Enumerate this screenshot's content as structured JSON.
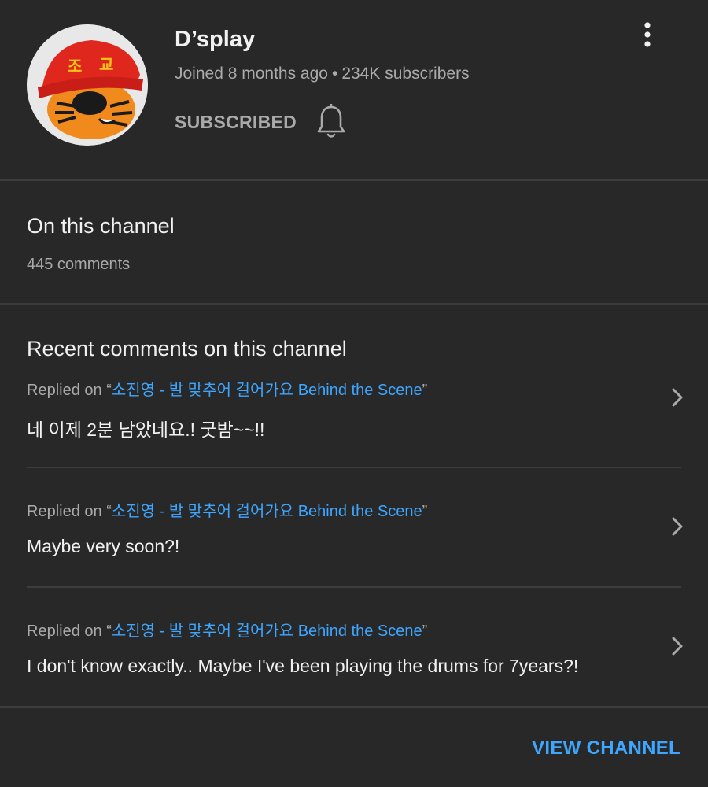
{
  "channel": {
    "name": "D’splay",
    "joined": "Joined 8 months ago",
    "separator": "•",
    "subscribers": "234K subscribers",
    "subscribed_label": "SUBSCRIBED",
    "avatar_text": "조 교"
  },
  "on_channel": {
    "title": "On this channel",
    "comments_count": "445 comments"
  },
  "recent": {
    "title": "Recent comments on this channel",
    "comments": [
      {
        "prefix": "Replied on ",
        "open_quote": "“",
        "video": "소진영 - 발 맞추어 걸어가요 Behind the Scene",
        "close_quote": "”",
        "text": "네 이제 2분 남았네요.! 굿밤~~!!"
      },
      {
        "prefix": "Replied on ",
        "open_quote": "“",
        "video": "소진영 - 발 맞추어 걸어가요 Behind the Scene",
        "close_quote": "”",
        "text": "Maybe very soon?!"
      },
      {
        "prefix": "Replied on ",
        "open_quote": "“",
        "video": "소진영 - 발 맞추어 걸어가요 Behind the Scene",
        "close_quote": "”",
        "text": "I don't know exactly.. Maybe I've been playing the drums for 7years?!"
      }
    ]
  },
  "footer": {
    "view_channel_label": "VIEW CHANNEL"
  },
  "colors": {
    "background": "#282828",
    "link": "#3ea6ff",
    "secondary_text": "#aaaaaa"
  }
}
